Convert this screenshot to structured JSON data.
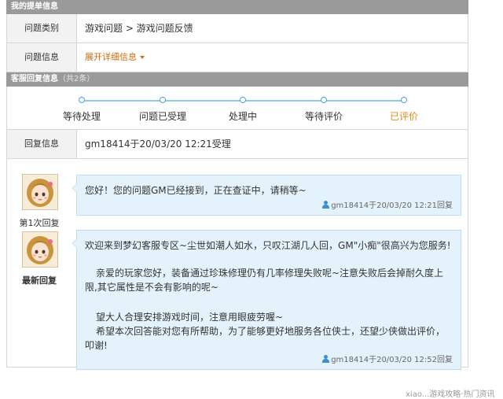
{
  "ticket_section": {
    "title": "我的提单信息",
    "rows": [
      {
        "label": "问题类别",
        "value": "游戏问题 > 游戏问题反馈"
      },
      {
        "label": "问题信息",
        "link": "展开详细信息"
      }
    ]
  },
  "reply_section": {
    "title": "客服回复信息",
    "count": "（共2条）",
    "steps": [
      "等待处理",
      "问题已受理",
      "处理中",
      "等待评价",
      "已评价"
    ],
    "active_step": 4,
    "reply_info_label": "回复信息",
    "reply_info_value": "gm18414于20/03/20 12:21受理"
  },
  "replies": [
    {
      "avatar_label": "第1次回复",
      "text": "您好！您的问题GM已经接到，正在查证中，请稍等~",
      "meta": "gm18414于20/03/20 12:21回复"
    },
    {
      "avatar_label": "最新回复",
      "paragraphs": [
        "欢迎来到梦幻客服专区~尘世如潮人如水，只叹江湖几人回，GM\"小痴\"很高兴为您服务!",
        "亲爱的玩家您好，装备通过珍珠修理仍有几率修理失败呢~注意失败后会掉耐久度上限,其它属性是不会有影响的呢~",
        "望大人合理安排游戏时间，注意用眼疲劳喔~",
        "希望本次回答能对您有所帮助，为了能够更好地服务各位侠士，还望少侠做出评价，叩谢!"
      ],
      "meta": "gm18414于20/03/20 12:52回复"
    }
  ],
  "footer_mark": "xiao...游戏攻略·热门资讯"
}
